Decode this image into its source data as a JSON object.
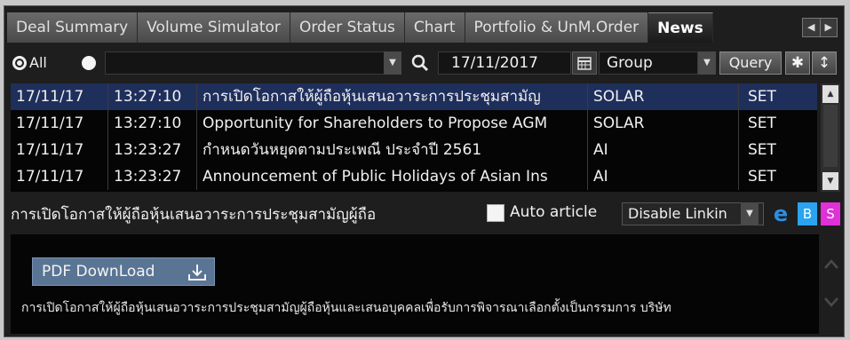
{
  "tabs": [
    {
      "label": "Deal Summary",
      "active": false
    },
    {
      "label": "Volume Simulator",
      "active": false
    },
    {
      "label": "Order Status",
      "active": false
    },
    {
      "label": "Chart",
      "active": false
    },
    {
      "label": "Portfolio & UnM.Order",
      "active": false
    },
    {
      "label": "News",
      "active": true
    }
  ],
  "filter": {
    "radio_all_label": "All",
    "date": "17/11/2017",
    "group": "Group",
    "query_label": "Query"
  },
  "news": {
    "rows": [
      {
        "date": "17/11/17",
        "time": "13:27:10",
        "headline": "การเปิดโอกาสให้ผู้ถือหุ้นเสนอวาระการประชุมสามัญ",
        "symbol": "SOLAR",
        "market": "SET"
      },
      {
        "date": "17/11/17",
        "time": "13:27:10",
        "headline": "Opportunity for Shareholders to Propose AGM",
        "symbol": "SOLAR",
        "market": "SET"
      },
      {
        "date": "17/11/17",
        "time": "13:23:27",
        "headline": "กำหนดวันหยุดตามประเพณี ประจำปี 2561",
        "symbol": "AI",
        "market": "SET"
      },
      {
        "date": "17/11/17",
        "time": "13:23:27",
        "headline": "Announcement of Public Holidays of Asian Ins",
        "symbol": "AI",
        "market": "SET"
      }
    ],
    "selected_index": 0
  },
  "detail": {
    "title": "การเปิดโอกาสให้ผู้ถือหุ้นเสนอวาระการประชุมสามัญผู้ถือ",
    "auto_article_label": "Auto article",
    "linking": "Disable Linkin",
    "b_label": "B",
    "s_label": "S"
  },
  "article": {
    "pdf_label": "PDF DownLoad",
    "body": "การเปิดโอกาสให้ผู้ถือหุ้นเสนอวาระการประชุมสามัญผู้ถือหุ้นและเสนอบุคคลเพื่อรับการพิจารณาเลือกตั้งเป็นกรรมการ บริษัท"
  },
  "colors": {
    "selected_row": "#1f2f5c",
    "pdf_button": "#5a7494",
    "b_button": "#2aa3f0",
    "s_button": "#e030d8"
  }
}
